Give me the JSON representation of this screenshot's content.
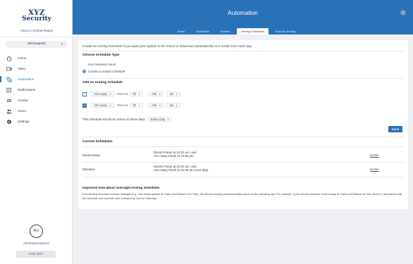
{
  "brand": {
    "logo_line1": "XYZ",
    "logo_line2": "Security"
  },
  "sidebar": {
    "back_link": "‹ Back to Central Region",
    "location": "Minneapolis",
    "items": [
      {
        "label": "Home",
        "icon": "home-icon",
        "active": false
      },
      {
        "label": "Video",
        "icon": "video-icon",
        "active": false
      },
      {
        "label": "Automation",
        "icon": "automation-icon",
        "active": true
      },
      {
        "label": "Notifications",
        "icon": "notifications-icon",
        "active": false
      },
      {
        "label": "Activity",
        "icon": "activity-icon",
        "active": false
      },
      {
        "label": "Users",
        "icon": "users-icon",
        "active": false
      },
      {
        "label": "Settings",
        "icon": "settings-icon",
        "active": false
      }
    ],
    "avatar_initials": "RJ",
    "username": "ADCBusinessDemo",
    "logout": "LOG OUT"
  },
  "header": {
    "title": "Automation",
    "tabs": [
      {
        "label": "Rules",
        "active": false
      },
      {
        "label": "Schedules",
        "active": false
      },
      {
        "label": "Scenes",
        "active": false
      },
      {
        "label": "Arming Schedules",
        "active": true
      },
      {
        "label": "Auto Re-Arming",
        "active": false
      }
    ]
  },
  "main": {
    "intro": "Create an Arming Schedule if you want your system to be Armed or Disarmed automatically at a certain time each day.",
    "choose_type_heading": "Choose Schedule Type",
    "option_business": "Use business hours",
    "option_custom": "Create a custom schedule",
    "add_heading": "Add an Arming Schedule",
    "rows": [
      {
        "action": "Arm Away",
        "panel_text": "Panel at",
        "hour": "hh",
        "colon": ":",
        "minute": "mm",
        "ampm": "am"
      },
      {
        "action": "Arm Away",
        "panel_text": "Panel at",
        "hour": "hh",
        "colon": ":",
        "minute": "mm",
        "ampm": "am"
      }
    ],
    "days_text": "This schedule should be active on these days:",
    "days_value": "Every Day",
    "save": "SAVE",
    "current_heading": "Current Schedules",
    "schedules": [
      {
        "day": "Wednesdays",
        "line1": "Disarm Panel at 10:30 am, and",
        "line2": "Arm Away Panel at 10:50 pm.",
        "delete": "Delete"
      },
      {
        "day": "Mondays",
        "line1": "Disarm Panel at 10:40 am, and",
        "line2": "Arm Away Panel at 10:30 am (next day).",
        "delete": "Delete"
      }
    ],
    "note_heading": "Important note about overnight Arming Schedules",
    "note_text": "If an Arming Schedule crosses midnight (e.g., Arm Away system at 10pm, and Disarm it at 7am), the second arming command takes place on the following day. For example, if you set the schedule to Arm Away at 10pm and Disarm at 7am, Mon-Fri, this means that the schedule will conclude with a Disarm at 7am on Saturday."
  },
  "colors": {
    "accent": "#2a72b8",
    "background": "#eef0f3"
  }
}
